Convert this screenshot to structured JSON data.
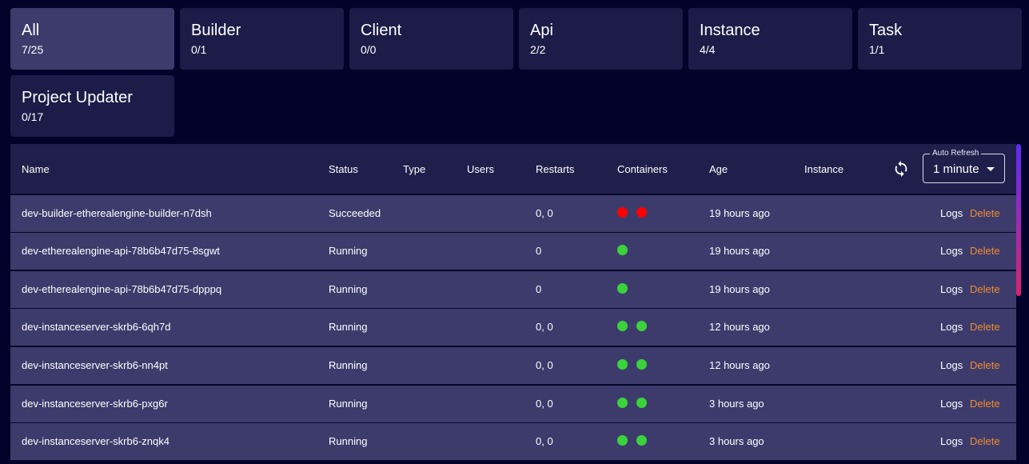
{
  "colors": {
    "background": "#02022a",
    "card": "#1d1c48",
    "card_active": "#3d3b6c",
    "row": "#3d3b6c",
    "header": "#201f4c",
    "delete": "#ef8d2c",
    "dot_red": "#ff0000",
    "dot_green": "#3bd33b"
  },
  "cards": [
    {
      "label": "All",
      "count": "7/25"
    },
    {
      "label": "Builder",
      "count": "0/1"
    },
    {
      "label": "Client",
      "count": "0/0"
    },
    {
      "label": "Api",
      "count": "2/2"
    },
    {
      "label": "Instance",
      "count": "4/4"
    },
    {
      "label": "Task",
      "count": "1/1"
    },
    {
      "label": "Project Updater",
      "count": "0/17"
    }
  ],
  "table": {
    "columns": [
      "Name",
      "Status",
      "Type",
      "Users",
      "Restarts",
      "Containers",
      "Age",
      "Instance"
    ],
    "auto_refresh": {
      "label": "Auto Refresh",
      "value": "1 minute",
      "icon": "refresh-icon"
    },
    "logs_label": "Logs",
    "delete_label": "Delete",
    "rows": [
      {
        "name": "dev-builder-etherealengine-builder-n7dsh",
        "status": "Succeeded",
        "type": "",
        "users": "",
        "restarts": "0, 0",
        "containers": [
          "red",
          "red"
        ],
        "age": "19 hours ago",
        "instance": ""
      },
      {
        "name": "dev-etherealengine-api-78b6b47d75-8sgwt",
        "status": "Running",
        "type": "",
        "users": "",
        "restarts": "0",
        "containers": [
          "green"
        ],
        "age": "19 hours ago",
        "instance": ""
      },
      {
        "name": "dev-etherealengine-api-78b6b47d75-dpppq",
        "status": "Running",
        "type": "",
        "users": "",
        "restarts": "0",
        "containers": [
          "green"
        ],
        "age": "19 hours ago",
        "instance": ""
      },
      {
        "name": "dev-instanceserver-skrb6-6qh7d",
        "status": "Running",
        "type": "",
        "users": "",
        "restarts": "0, 0",
        "containers": [
          "green",
          "green"
        ],
        "age": "12 hours ago",
        "instance": ""
      },
      {
        "name": "dev-instanceserver-skrb6-nn4pt",
        "status": "Running",
        "type": "",
        "users": "",
        "restarts": "0, 0",
        "containers": [
          "green",
          "green"
        ],
        "age": "12 hours ago",
        "instance": ""
      },
      {
        "name": "dev-instanceserver-skrb6-pxg6r",
        "status": "Running",
        "type": "",
        "users": "",
        "restarts": "0, 0",
        "containers": [
          "green",
          "green"
        ],
        "age": "3 hours ago",
        "instance": ""
      },
      {
        "name": "dev-instanceserver-skrb6-znqk4",
        "status": "Running",
        "type": "",
        "users": "",
        "restarts": "0, 0",
        "containers": [
          "green",
          "green"
        ],
        "age": "3 hours ago",
        "instance": ""
      }
    ]
  }
}
